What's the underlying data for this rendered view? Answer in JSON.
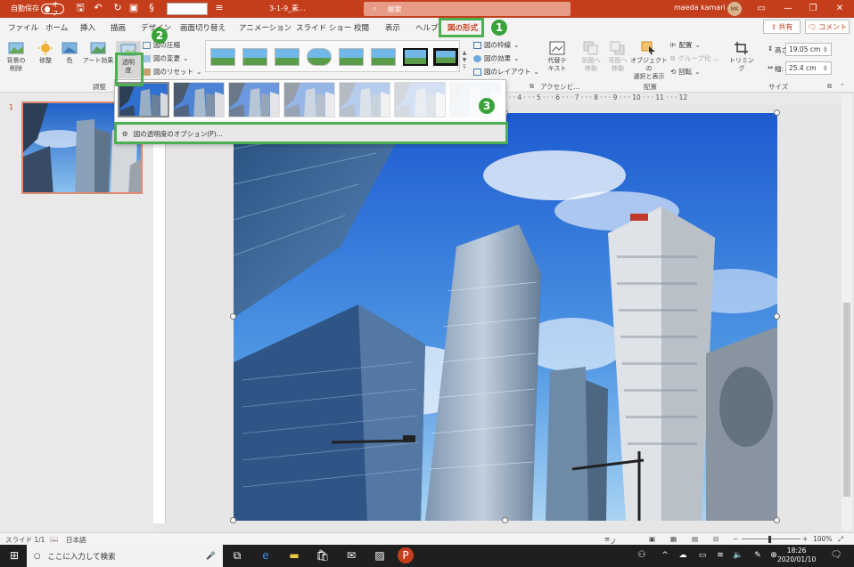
{
  "titlebar": {
    "autosave_label": "自動保存",
    "autosave_state": "オフ",
    "doc_title": "3-1-9_素…",
    "search_placeholder": "検索",
    "user_name": "maeda kamari",
    "user_initials": "MK"
  },
  "tabs": [
    "ファイル",
    "ホーム",
    "挿入",
    "描画",
    "デザイン",
    "画面切り替え",
    "アニメーション",
    "スライド ショー",
    "校閲",
    "表示",
    "ヘルプ",
    "図の形式"
  ],
  "active_tab": "図の形式",
  "share_label": "共有",
  "comment_label": "コメント",
  "ribbon": {
    "remove_bg": "背景の\n削除",
    "corrections": "修整",
    "color": "色",
    "art_effects": "アート効果",
    "transparency": "透明\n度",
    "compress": "図の圧縮",
    "change_picture": "図の変更",
    "reset_picture": "図のリセット",
    "adjust_group": "調整",
    "border": "図の枠線",
    "effects": "図の効果",
    "layout": "図のレイアウト",
    "alt_text": "代替テ\nキスト",
    "accessibility_group": "アクセシビ…",
    "bring_forward": "前面へ\n移動",
    "send_backward": "背面へ\n移動",
    "selection_pane": "オブジェクトの\n選択と表示",
    "align": "配置",
    "group": "グループ化",
    "rotate": "回転",
    "arrange_group": "配置",
    "crop": "トリミング",
    "height_label": "高さ:",
    "height_value": "19.05 cm",
    "width_label": "幅:",
    "width_value": "25.4 cm",
    "size_group": "サイズ"
  },
  "dropdown": {
    "option_label": "図の透明度のオプション(P)...",
    "presets": [
      0,
      15,
      30,
      50,
      65,
      80,
      95
    ]
  },
  "annotations": [
    "1",
    "2",
    "3"
  ],
  "slides": {
    "current_number": "1"
  },
  "ruler_numbers": "1 · · · 2 · · · 3 · · · 4 · · · 5 · · · 6 · · · 7 · · · 8 · · · 9 · · · 10 · · · 11 · · · 12",
  "statusbar": {
    "slide_info": "スライド 1/1",
    "language": "日本語",
    "notes": "ノート",
    "zoom": "100%"
  },
  "taskbar": {
    "search_placeholder": "ここに入力して検索",
    "time": "18:26",
    "date": "2020/01/10"
  }
}
